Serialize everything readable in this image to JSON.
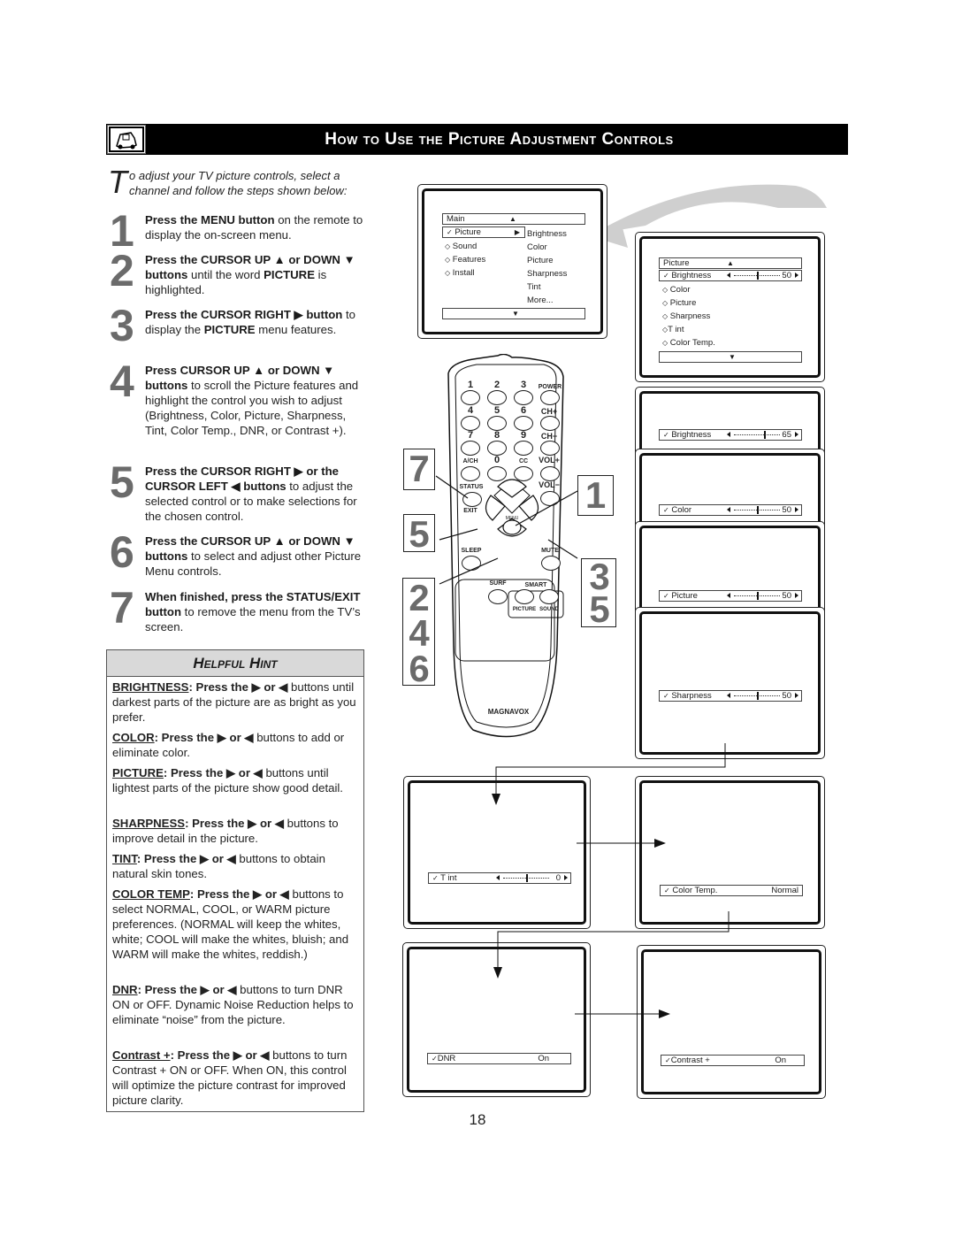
{
  "header": {
    "title": "How to Use the Picture Adjustment Controls",
    "icon": "tv-remote-icon"
  },
  "intro": {
    "dropcap": "T",
    "text": "o adjust your TV picture controls, select a channel and follow the steps shown below:"
  },
  "steps": [
    {
      "num": "1",
      "bold1": "Press the MENU button",
      "rest1": " on the remote to display the on-screen menu."
    },
    {
      "num": "2",
      "bold1": "Press the CURSOR UP ▲ or DOWN ▼ buttons",
      "rest1": " until the word ",
      "bold2": "PICTURE",
      "rest2": " is highlighted."
    },
    {
      "num": "3",
      "bold1": "Press the CURSOR RIGHT ▶ button",
      "rest1": " to display the ",
      "bold2": "PICTURE",
      "rest2": " menu features."
    },
    {
      "num": "4",
      "bold1": "Press CURSOR UP ▲ or DOWN ▼ buttons",
      "rest1": " to scroll the Picture features and highlight the control you wish to adjust (Brightness, Color, Picture, Sharpness, Tint, Color Temp., DNR, or Contrast +)."
    },
    {
      "num": "5",
      "bold1": "Press the CURSOR RIGHT ▶ or the CURSOR LEFT ◀ buttons",
      "rest1": " to adjust the selected control or to make selections for the chosen control."
    },
    {
      "num": "6",
      "bold1": "Press the CURSOR UP ▲ or DOWN ▼ buttons",
      "rest1": " to select and adjust other Picture Menu controls."
    },
    {
      "num": "7",
      "bold1": "When finished, press the STATUS/EXIT button",
      "rest1": " to remove the menu from the TV’s screen."
    }
  ],
  "hint": {
    "title": "Helpful Hint",
    "items": [
      {
        "label": "BRIGHTNESS",
        "bold": ":  Press the ▶ or ◀",
        "text": " buttons until darkest parts of the picture are as bright as you prefer."
      },
      {
        "label": "COLOR",
        "bold": ":  Press the ▶ or ◀",
        "text": " buttons to add or eliminate color."
      },
      {
        "label": "PICTURE",
        "bold": ":  Press the ▶ or ◀",
        "text": " buttons until lightest parts of the picture show good detail."
      },
      {
        "label": "SHARPNESS",
        "bold": ":  Press the ▶ or ◀",
        "text": " buttons to improve detail in the picture."
      },
      {
        "label": "TINT",
        "bold": ":  Press the ▶ or ◀",
        "text": " buttons to obtain natural skin tones."
      },
      {
        "label": "COLOR TEMP",
        "bold": ": Press the ▶ or ◀",
        "text": " buttons to select NORMAL, COOL, or WARM picture preferences. (NORMAL will keep the whites, white; COOL will make the whites, bluish; and WARM will make the whites, reddish.)"
      },
      {
        "label": "DNR",
        "bold": ": Press the ▶ or ◀",
        "text": " buttons to turn DNR ON or OFF. Dynamic Noise Reduction helps to eliminate “noise” from the picture."
      },
      {
        "label": "Contrast +",
        "bold": ": Press the ▶ or ◀",
        "text": " buttons to turn Contrast + ON or OFF. When ON, this control will optimize the picture contrast for improved picture clarity."
      }
    ]
  },
  "main_menu": {
    "title": "Main",
    "items": [
      "Picture",
      "Sound",
      "Features",
      "Install"
    ],
    "selected": "Picture",
    "submenu": [
      "Brightness",
      "Color",
      "Picture",
      "Sharpness",
      "Tint",
      "More..."
    ]
  },
  "picture_menu": {
    "title": "Picture",
    "items": [
      "Brightness",
      "Color",
      "Picture",
      "Sharpness",
      "T int",
      "Color Temp."
    ],
    "selected": "Brightness",
    "selected_value": "50"
  },
  "screens": [
    {
      "label": "Brightness",
      "value": "65",
      "slider_fraction": 0.65
    },
    {
      "label": "Color",
      "value": "50",
      "slider_fraction": 0.5
    },
    {
      "label": "Picture",
      "value": "50",
      "slider_fraction": 0.5
    },
    {
      "label": "Sharpness",
      "value": "50",
      "slider_fraction": 0.5
    },
    {
      "label": "T int",
      "value": "0",
      "slider_fraction": 0.5
    },
    {
      "label": "Color Temp.",
      "value": "Normal"
    },
    {
      "label": "DNR",
      "value": "On"
    },
    {
      "label": "Contrast +",
      "value": "On"
    }
  ],
  "remote": {
    "brand": "MAGNAVOX",
    "keys": [
      "1",
      "2",
      "3",
      "4",
      "5",
      "6",
      "7",
      "8",
      "9",
      "0"
    ],
    "labels": {
      "power": "POWER",
      "ch_up": "CH+",
      "ch_down": "CH−",
      "vol_up": "VOL+",
      "vol_down": "VOL−",
      "ach": "A/CH",
      "cc": "CC",
      "status": "STATUS",
      "exit": "EXIT",
      "menu": "MENU",
      "sleep": "SLEEP",
      "mute": "MUTE",
      "surf": "SURF",
      "smart": "SMART",
      "picture": "PICTURE",
      "sound": "SOUND"
    },
    "callouts": {
      "left_top": "7",
      "left_mid": "5",
      "left_bottom": [
        "2",
        "4",
        "6"
      ],
      "right_top": "1",
      "right_bottom": [
        "3",
        "5"
      ]
    }
  },
  "page_number": "18"
}
